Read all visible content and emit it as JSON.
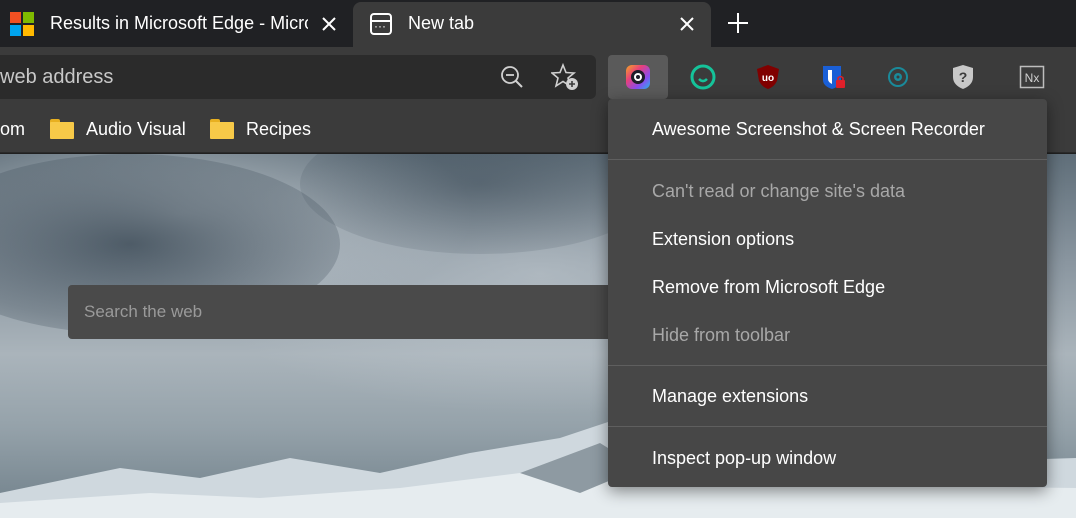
{
  "tabs": [
    {
      "title": "Results in Microsoft Edge - Microsoft Bing",
      "close": "✕"
    },
    {
      "title": "New tab",
      "close": "✕"
    }
  ],
  "new_tab_button": "+",
  "omnibox": {
    "placeholder": "web address"
  },
  "favorites": [
    {
      "label": "om"
    },
    {
      "label": "Audio Visual"
    },
    {
      "label": "Recipes"
    }
  ],
  "ntp": {
    "search_placeholder": "Search the web"
  },
  "extensions": [
    {
      "icon": "awesome-screenshot-icon"
    },
    {
      "icon": "grammarly-icon"
    },
    {
      "icon": "ublock-origin-icon"
    },
    {
      "icon": "privacy-shield-icon"
    },
    {
      "icon": "teal-eye-icon"
    },
    {
      "icon": "question-shield-icon"
    },
    {
      "icon": "nx-icon",
      "label": "Nx"
    }
  ],
  "menu": {
    "title": "Awesome Screenshot & Screen Recorder",
    "items": [
      {
        "label": "Can't read or change site's data",
        "enabled": false
      },
      {
        "label": "Extension options",
        "enabled": true
      },
      {
        "label": "Remove from Microsoft Edge",
        "enabled": true
      },
      {
        "label": "Hide from toolbar",
        "enabled": false
      },
      {
        "label": "Manage extensions",
        "enabled": true
      },
      {
        "label": "Inspect pop-up window",
        "enabled": true
      }
    ]
  },
  "colors": {
    "menu_bg": "#474747",
    "toolbar_bg": "#3b3b3b",
    "tabstrip_bg": "#202124"
  }
}
